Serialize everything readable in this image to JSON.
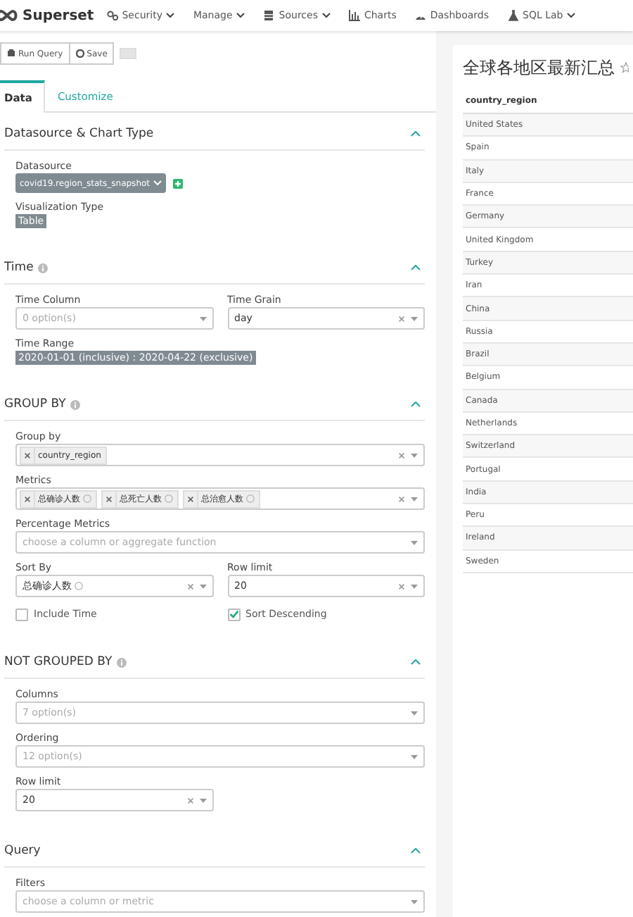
{
  "navbar": {
    "brand": "Superset",
    "items": [
      {
        "label": "Security",
        "dropdown": true
      },
      {
        "label": "Manage",
        "dropdown": true
      },
      {
        "label": "Sources",
        "dropdown": true
      },
      {
        "label": "Charts",
        "dropdown": false
      },
      {
        "label": "Dashboards",
        "dropdown": false
      },
      {
        "label": "SQL Lab",
        "dropdown": true
      }
    ]
  },
  "toolbar": {
    "buttons": [
      "Run Query",
      "Save"
    ]
  },
  "tabs": [
    {
      "label": "Data",
      "selected": true
    },
    {
      "label": "Customize",
      "selected": false
    }
  ],
  "sections": [
    {
      "title": "Datasource & Chart Type",
      "info": false,
      "expanded": true,
      "controls": [
        {
          "kind": "datasource",
          "label": "Datasource",
          "value": "covid19.region_stats_snapshot"
        },
        {
          "kind": "badge",
          "label": "Visualization Type",
          "value": "Table"
        }
      ]
    },
    {
      "title": "Time",
      "info": true,
      "expanded": true,
      "controls": [
        {
          "kind": "pair",
          "items": [
            {
              "kind": "select",
              "label": "Time Column",
              "placeholder": "0 option(s)",
              "clearable": false
            },
            {
              "kind": "select",
              "label": "Time Grain",
              "value": "day",
              "clearable": true
            }
          ]
        },
        {
          "kind": "badge",
          "label": "Time Range",
          "value": "2020-01-01 (inclusive) : 2020-04-22 (exclusive)"
        }
      ]
    },
    {
      "title": "GROUP BY",
      "info": true,
      "expanded": true,
      "controls": [
        {
          "kind": "select",
          "label": "Group by",
          "chips": [
            {
              "text": "country_region",
              "help": false
            }
          ],
          "clearable": true
        },
        {
          "kind": "select",
          "label": "Metrics",
          "chips": [
            {
              "text": "总确诊人数",
              "help": true
            },
            {
              "text": "总死亡人数",
              "help": true
            },
            {
              "text": "总治愈人数",
              "help": true
            }
          ],
          "clearable": true
        },
        {
          "kind": "select",
          "label": "Percentage Metrics",
          "placeholder": "choose a column or aggregate function",
          "clearable": false
        },
        {
          "kind": "pair",
          "items": [
            {
              "kind": "select",
              "label": "Sort By",
              "value": "总确诊人数",
              "help": true,
              "clearable": true
            },
            {
              "kind": "select",
              "label": "Row limit",
              "value": "20",
              "clearable": true
            }
          ]
        },
        {
          "kind": "pair",
          "items": [
            {
              "kind": "checkbox",
              "label": "Include Time",
              "checked": false
            },
            {
              "kind": "checkbox",
              "label": "Sort Descending",
              "checked": true
            }
          ]
        }
      ]
    },
    {
      "title": "NOT GROUPED BY",
      "info": true,
      "expanded": true,
      "controls": [
        {
          "kind": "select",
          "label": "Columns",
          "placeholder": "7 option(s)",
          "clearable": false
        },
        {
          "kind": "select",
          "label": "Ordering",
          "placeholder": "12 option(s)",
          "clearable": false
        },
        {
          "kind": "pair",
          "items": [
            {
              "kind": "select",
              "label": "Row limit",
              "value": "20",
              "clearable": true
            }
          ]
        }
      ]
    },
    {
      "title": "Query",
      "info": false,
      "expanded": true,
      "controls": [
        {
          "kind": "select",
          "label": "Filters",
          "placeholder": "choose a column or metric",
          "clearable": false
        }
      ]
    }
  ],
  "chart": {
    "title": "全球各地区最新汇总",
    "table": {
      "columns": [
        "country_region"
      ],
      "rows": [
        "United States",
        "Spain",
        "Italy",
        "France",
        "Germany",
        "United Kingdom",
        "Turkey",
        "Iran",
        "China",
        "Russia",
        "Brazil",
        "Belgium",
        "Canada",
        "Netherlands",
        "Switzerland",
        "Portugal",
        "India",
        "Peru",
        "Ireland",
        "Sweden"
      ]
    }
  }
}
